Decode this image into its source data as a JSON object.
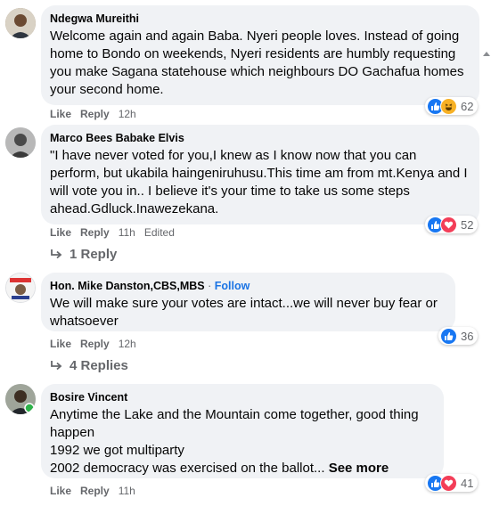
{
  "comments": [
    {
      "author": "Ndegwa Mureithi",
      "text": "Welcome again and again Baba. Nyeri people loves. Instead of going home to Bondo on weekends, Nyeri residents are humbly requesting you make Sagana statehouse which neighbours DO Gachafua homes your second home.",
      "like": "Like",
      "reply": "Reply",
      "time": "12h",
      "reaction_count": "62",
      "reactions": [
        "like-icon",
        "haha-icon"
      ]
    },
    {
      "author": "Marco Bees Babake Elvis",
      "text": "\"I have never voted for you,I knew as I know now that you can perform, but ukabila haingeniruhusu.This time am from mt.Kenya and I will vote you in.. I believe it's your time to take us some steps ahead.Gdluck.Inawezekana.",
      "like": "Like",
      "reply": "Reply",
      "time": "11h",
      "edited": "Edited",
      "reaction_count": "52",
      "reactions": [
        "like-icon",
        "love-icon"
      ],
      "replies_label": "1 Reply"
    },
    {
      "author": "Hon. Mike Danston,CBS,MBS",
      "follow_dot": "·",
      "follow": "Follow",
      "text": "We will make sure your votes are intact...we will never buy fear or whatsoever",
      "like": "Like",
      "reply": "Reply",
      "time": "12h",
      "reaction_count": "36",
      "reactions": [
        "like-icon"
      ],
      "replies_label": "4 Replies"
    },
    {
      "author": "Bosire Vincent",
      "text": "Anytime the Lake and the Mountain come together, good thing happen\n1992 we got multiparty\n2002 democracy was exercised on the ballot...",
      "see_more": "See more",
      "like": "Like",
      "reply": "Reply",
      "time": "11h",
      "reaction_count": "41",
      "reactions": [
        "like-icon",
        "love-icon"
      ]
    }
  ],
  "colors": {
    "bubble": "#f0f2f5",
    "like_blue": "#1877f2",
    "love_red": "#f33e58",
    "haha_yellow": "#f7b125",
    "secondary_text": "#65676b",
    "follow_blue": "#1b74e4"
  }
}
